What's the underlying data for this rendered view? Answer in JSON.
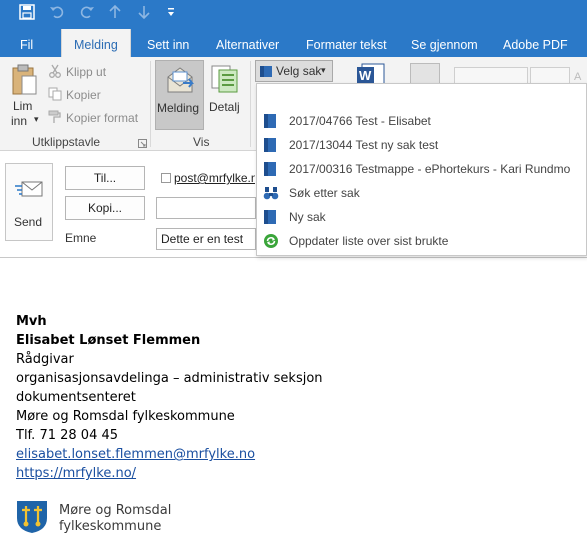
{
  "quick_access": {
    "save_icon": "save-icon",
    "undo_icon": "undo-icon",
    "redo_icon": "redo-icon",
    "up_icon": "arrow-up-icon",
    "down_icon": "arrow-down-icon",
    "customize_icon": "customize-icon"
  },
  "tabs": [
    {
      "label": "Fil"
    },
    {
      "label": "Melding"
    },
    {
      "label": "Sett inn"
    },
    {
      "label": "Alternativer"
    },
    {
      "label": "Formater tekst"
    },
    {
      "label": "Se gjennom"
    },
    {
      "label": "Adobe PDF"
    }
  ],
  "ribbon": {
    "clipboard": {
      "paste_label_1": "Lim",
      "paste_label_2": "inn",
      "paste_caret": "▾",
      "cut": "Klipp ut",
      "copy": "Kopier",
      "format_painter": "Kopier format",
      "group_label": "Utklippstavle"
    },
    "view": {
      "message": "Melding",
      "detail": "Detalj",
      "group_label": "Vis"
    },
    "velg_sak": "Velg sak",
    "velg_caret": "▾"
  },
  "dropdown": {
    "items": [
      {
        "label": "2017/04766 Test - Elisabet",
        "icon": "folder-icon"
      },
      {
        "label": "2017/13044 Test ny sak test",
        "icon": "folder-icon"
      },
      {
        "label": "2017/00316 Testmappe - ePhortekurs - Kari Rundmo",
        "icon": "folder-icon"
      },
      {
        "label": "Søk etter sak",
        "icon": "binoculars-icon"
      },
      {
        "label": "Ny sak",
        "icon": "folder-icon"
      },
      {
        "label": "Oppdater liste over sist brukte",
        "icon": "refresh-icon"
      }
    ]
  },
  "compose": {
    "send": "Send",
    "to_button": "Til...",
    "cc_button": "Kopi...",
    "subject_label": "Emne",
    "to_value": "post@mrfylke.no",
    "cc_value": "",
    "subject_value": "Dette er en test"
  },
  "signature": {
    "greeting": "Mvh",
    "name": "Elisabet Lønset Flemmen",
    "title": "Rådgivar",
    "dept": "organisasjonsavdelinga – administrativ seksjon",
    "unit": "dokumentsenteret",
    "org": "Møre og Romsdal fylkeskommune",
    "phone": "Tlf. 71 28 04 45",
    "email": "elisabet.lonset.flemmen@mrfylke.no",
    "web": "https://mrfylke.no/",
    "logo_line1": "Møre og Romsdal",
    "logo_line2": "fylkeskommune"
  },
  "colors": {
    "accent": "#2b79c8",
    "ribbon_bg": "#f3f3f3",
    "link": "#1a4fa0"
  }
}
